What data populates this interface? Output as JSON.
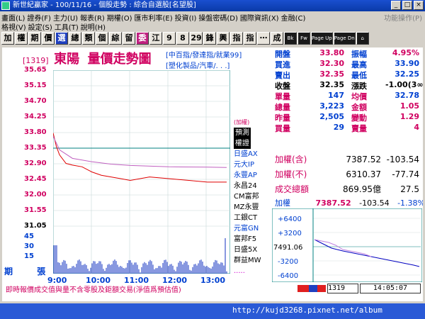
{
  "window": {
    "title": "新世紀贏家 - 100/11/16 - 個股走勢 : 綜合自選股[名望股]"
  },
  "menu": {
    "row1": [
      "畫面(L)",
      "證券(F)",
      "主力(U)",
      "報表(R)",
      "期權(O)",
      "匯市利率(E)",
      "投資(I)",
      "操盤密碼(D)",
      "國際資訊(X)",
      "金融(C)"
    ],
    "row2": [
      "格視(V)",
      "設定(S)",
      "工具(T)",
      "說明(H)"
    ],
    "right": "功能操作(P)"
  },
  "toolbar": [
    "加",
    "權",
    "期",
    "價",
    "選",
    "總",
    "類",
    "個",
    "綜",
    "留",
    "委",
    "江",
    "9",
    "8",
    "29",
    "鋒",
    "興",
    "指",
    "指",
    "⋯",
    "成",
    "Bk",
    "Fw",
    "Page Up",
    "Page Dn",
    "⌂"
  ],
  "stock": {
    "code": "[1319]",
    "name": "東陽",
    "chart_title": "量價走勢圖"
  },
  "indices_tags": {
    "line1": "[中百指/發達指/就業99]",
    "line2": "[塑化製品/汽車/. . .]"
  },
  "quote": [
    {
      "l": "開盤",
      "v": "33.80",
      "l2": "振幅",
      "v2": "4.95%"
    },
    {
      "l": "買進",
      "v": "32.30",
      "l2": "最高",
      "v2": "33.90"
    },
    {
      "l": "賣出",
      "v": "32.35",
      "l2": "最低",
      "v2": "32.25"
    },
    {
      "l": "收盤",
      "v": "32.35",
      "l2": "漲跌",
      "v2": "-1.00(3∞)"
    },
    {
      "l": "單量",
      "v": "147",
      "l2": "均價",
      "v2": "32.78"
    },
    {
      "l": "總量",
      "v": "3,223",
      "l2": "金額",
      "v2": "1.05"
    },
    {
      "l": "昨量",
      "v": "2,505",
      "l2": "變動",
      "v2": "1.29"
    },
    {
      "l": "買量",
      "v": "29",
      "l2": "賣量",
      "v2": "4"
    }
  ],
  "chart_data": {
    "type": "line",
    "title": "量價走勢圖",
    "x_ticks": [
      "9:00",
      "10:00",
      "11:00",
      "12:00",
      "13:00"
    ],
    "y_ticks": [
      "35.65",
      "35.15",
      "34.70",
      "34.25",
      "33.80",
      "33.35",
      "32.90",
      "32.45",
      "32.00",
      "31.55",
      "31.05"
    ],
    "ylim": [
      31.05,
      35.65
    ],
    "reference_price": 33.35,
    "series": [
      {
        "name": "價格",
        "x_minutes": [
          0,
          5,
          10,
          20,
          30,
          45,
          60,
          75,
          90,
          105,
          120,
          150,
          180,
          210,
          240,
          270
        ],
        "values": [
          33.8,
          33.4,
          33.15,
          32.9,
          32.85,
          32.8,
          32.65,
          32.55,
          32.5,
          32.45,
          32.4,
          32.5,
          32.45,
          32.4,
          32.35,
          32.35
        ]
      },
      {
        "name": "均價",
        "x_minutes": [
          0,
          10,
          30,
          60,
          90,
          120,
          180,
          240,
          270
        ],
        "values": [
          33.7,
          33.3,
          33.05,
          32.95,
          32.88,
          32.84,
          32.8,
          32.79,
          32.78
        ]
      }
    ],
    "volume_ticks": [
      "45",
      "30",
      "15"
    ],
    "volume_label": "張"
  },
  "sidebox": {
    "label": "(加權)",
    "items": [
      "預測",
      "權證",
      "日盛AX",
      "元大IP",
      "永豐AP",
      "永昌24",
      "CM富邦",
      "MZ永豐",
      "工銀CT",
      "元富GN",
      "富邦F5",
      "日盛5X",
      "群益MW",
      "....."
    ]
  },
  "index_panel": [
    {
      "l": "加權(含)",
      "v": "7387.52",
      "c": "-103.54"
    },
    {
      "l": "加權(不)",
      "v": "6310.37",
      "c": "-77.74"
    },
    {
      "l": "成交總額",
      "v": "869.95億",
      "c": "27.5"
    }
  ],
  "mini": {
    "label": "加權",
    "value": "7387.52",
    "change": "-103.54",
    "pct": "-1.38%",
    "ticks": [
      "+6400",
      "+3200",
      "7491.06",
      "-3200",
      "-6400"
    ]
  },
  "period_label": "期",
  "status": {
    "message": "即時報價成交值與量不含零股及鉅額交易(淨值爲預估值)",
    "code": "1319",
    "time": "14:05:07"
  },
  "taskbar": {
    "url": "http://kujd3268.pixnet.net/album"
  }
}
